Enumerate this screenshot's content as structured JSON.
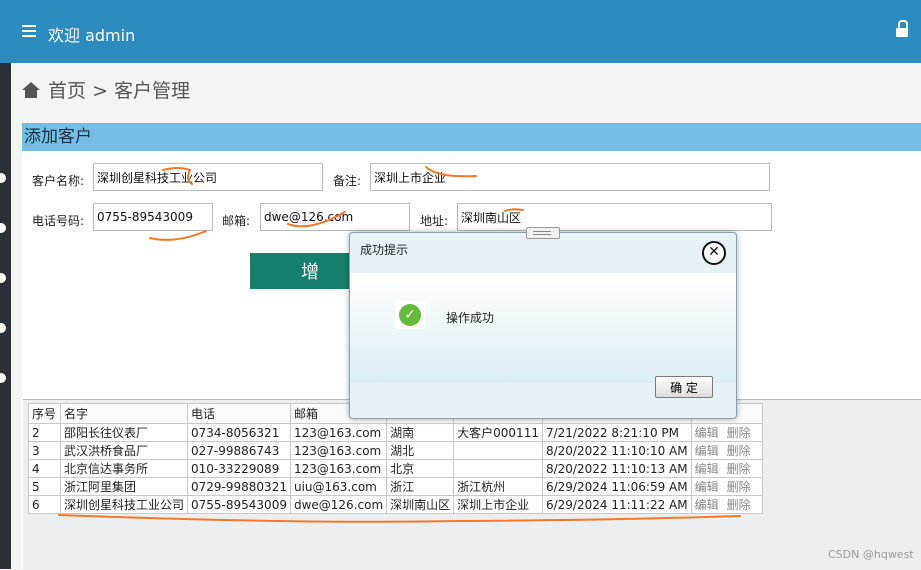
{
  "header": {
    "welcome": "欢迎 admin"
  },
  "breadcrumb": {
    "home": "首页",
    "sep": ">",
    "current": "客户管理"
  },
  "form": {
    "title": "添加客户",
    "name_label": "客户名称:",
    "name_value": "深圳创星科技工业公司",
    "note_label": "备注:",
    "note_value": "深圳上市企业",
    "phone_label": "电话号码:",
    "phone_value": "0755-89543009",
    "email_label": "邮箱:",
    "email_value": "dwe@126.com",
    "addr_label": "地址:",
    "addr_value": "深圳南山区",
    "add_button": "增"
  },
  "table": {
    "headers": [
      "序号",
      "名字",
      "电话",
      "邮箱"
    ],
    "rows": [
      {
        "no": "2",
        "name": "邵阳长往仪表厂",
        "phone": "0734-8056321",
        "email": "123@163.com",
        "addr": "湖南",
        "note": "大客户000111",
        "time": "7/21/2022 8:21:10 PM"
      },
      {
        "no": "3",
        "name": "武汉洪桥食品厂",
        "phone": "027-99886743",
        "email": "123@163.com",
        "addr": "湖北",
        "note": "",
        "time": "8/20/2022 11:10:10 AM"
      },
      {
        "no": "4",
        "name": "北京信达事务所",
        "phone": "010-33229089",
        "email": "123@163.com",
        "addr": "北京",
        "note": "",
        "time": "8/20/2022 11:10:13 AM"
      },
      {
        "no": "5",
        "name": "浙江阿里集团",
        "phone": "0729-99880321",
        "email": "uiu@163.com",
        "addr": "浙江",
        "note": "浙江杭州",
        "time": "6/29/2024 11:06:59 AM"
      },
      {
        "no": "6",
        "name": "深圳创星科技工业公司",
        "phone": "0755-89543009",
        "email": "dwe@126.com",
        "addr": "深圳南山区",
        "note": "深圳上市企业",
        "time": "6/29/2024 11:11:22 AM"
      }
    ],
    "edit_label": "编辑",
    "delete_label": "删除"
  },
  "dialog": {
    "title": "成功提示",
    "message": "操作成功",
    "ok": "确 定",
    "close_glyph": "✕"
  },
  "watermark": "CSDN @hqwest",
  "colors": {
    "header": "#2e8bc0",
    "section": "#74bde6",
    "button": "#167f6c",
    "annotation": "#f07a2c"
  }
}
